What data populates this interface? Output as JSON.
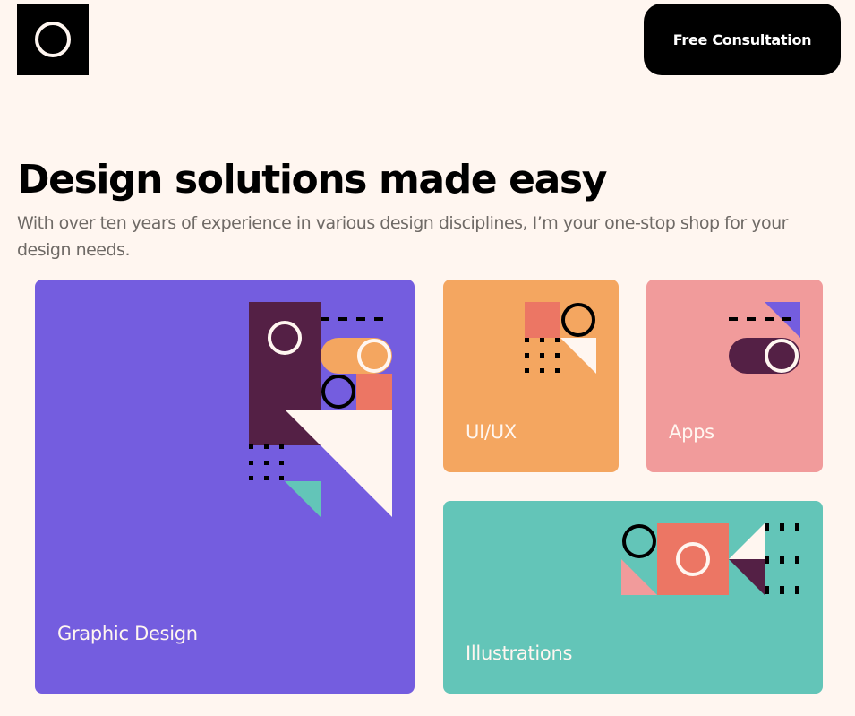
{
  "header": {
    "logo_icon": "ring-icon",
    "cta_label": "Free Consultation"
  },
  "hero": {
    "title": "Design solutions made easy",
    "subtitle": "With over ten years of experience in various design disciplines, I’m your one-stop shop for your design needs."
  },
  "services": [
    {
      "label": "Graphic Design",
      "color": "#745ddf"
    },
    {
      "label": "UI/UX",
      "color": "#f4a660"
    },
    {
      "label": "Apps",
      "color": "#f19b9b"
    },
    {
      "label": "Illustrations",
      "color": "#63c5b8"
    }
  ],
  "palette": {
    "background": "#fff6f0",
    "purple": "#745ddf",
    "plum": "#542045",
    "orange": "#f4a660",
    "coral": "#ec7664",
    "pink": "#f19b9b",
    "teal": "#63c5b8",
    "cream": "#fff6f0"
  }
}
